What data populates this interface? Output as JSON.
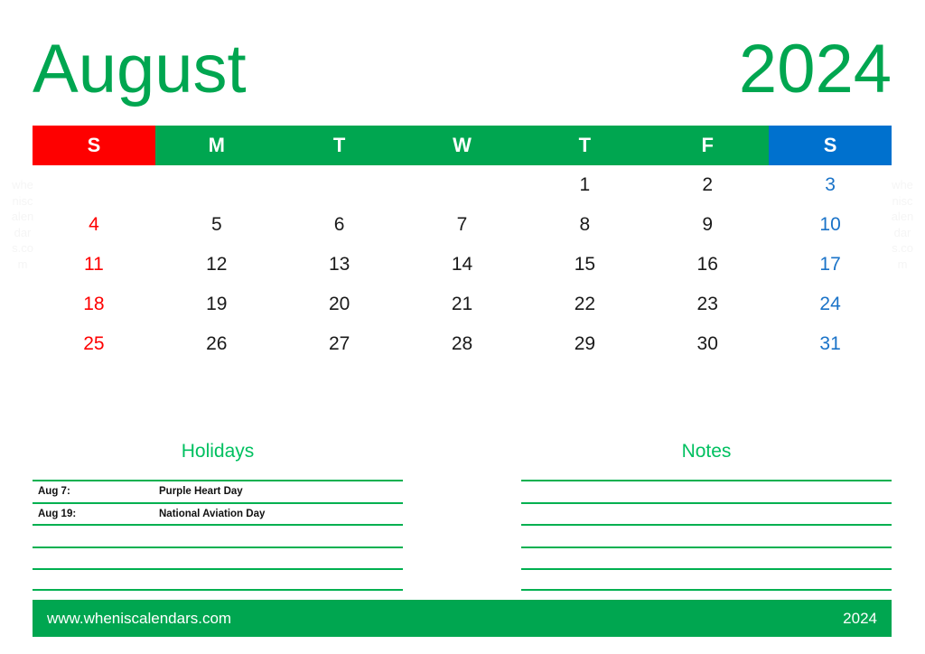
{
  "title": {
    "month": "August",
    "year": "2024"
  },
  "watermark": {
    "text": "wheniscalendars.com"
  },
  "colors": {
    "green": "#00a650",
    "green_light": "#00b050",
    "red": "#fe0000",
    "blue": "#0071ce",
    "date_blue": "#1a73c8",
    "date_black": "#1a1a1a",
    "title_green": "#00a650",
    "section_title_green": "#00c060",
    "watermark_gray": "#f5f5f5"
  },
  "weekdays": [
    {
      "label": "S",
      "kind": "sun"
    },
    {
      "label": "M",
      "kind": "weekday"
    },
    {
      "label": "T",
      "kind": "weekday"
    },
    {
      "label": "W",
      "kind": "weekday"
    },
    {
      "label": "T",
      "kind": "weekday"
    },
    {
      "label": "F",
      "kind": "weekday"
    },
    {
      "label": "S",
      "kind": "sat"
    }
  ],
  "weeks": [
    [
      {
        "day": "",
        "kind": "empty"
      },
      {
        "day": "",
        "kind": "empty"
      },
      {
        "day": "",
        "kind": "empty"
      },
      {
        "day": "",
        "kind": "empty"
      },
      {
        "day": "1",
        "kind": "weekday"
      },
      {
        "day": "2",
        "kind": "weekday"
      },
      {
        "day": "3",
        "kind": "sat"
      }
    ],
    [
      {
        "day": "4",
        "kind": "sun"
      },
      {
        "day": "5",
        "kind": "weekday"
      },
      {
        "day": "6",
        "kind": "weekday"
      },
      {
        "day": "7",
        "kind": "weekday"
      },
      {
        "day": "8",
        "kind": "weekday"
      },
      {
        "day": "9",
        "kind": "weekday"
      },
      {
        "day": "10",
        "kind": "sat"
      }
    ],
    [
      {
        "day": "11",
        "kind": "sun"
      },
      {
        "day": "12",
        "kind": "weekday"
      },
      {
        "day": "13",
        "kind": "weekday"
      },
      {
        "day": "14",
        "kind": "weekday"
      },
      {
        "day": "15",
        "kind": "weekday"
      },
      {
        "day": "16",
        "kind": "weekday"
      },
      {
        "day": "17",
        "kind": "sat"
      }
    ],
    [
      {
        "day": "18",
        "kind": "sun"
      },
      {
        "day": "19",
        "kind": "weekday"
      },
      {
        "day": "20",
        "kind": "weekday"
      },
      {
        "day": "21",
        "kind": "weekday"
      },
      {
        "day": "22",
        "kind": "weekday"
      },
      {
        "day": "23",
        "kind": "weekday"
      },
      {
        "day": "24",
        "kind": "sat"
      }
    ],
    [
      {
        "day": "25",
        "kind": "sun"
      },
      {
        "day": "26",
        "kind": "weekday"
      },
      {
        "day": "27",
        "kind": "weekday"
      },
      {
        "day": "28",
        "kind": "weekday"
      },
      {
        "day": "29",
        "kind": "weekday"
      },
      {
        "day": "30",
        "kind": "weekday"
      },
      {
        "day": "31",
        "kind": "sat"
      }
    ]
  ],
  "holidays": {
    "title": "Holidays",
    "rows": [
      {
        "date": "Aug 7:",
        "name": "Purple Heart Day"
      },
      {
        "date": "Aug 19:",
        "name": "National Aviation Day"
      },
      {
        "date": "",
        "name": ""
      },
      {
        "date": "",
        "name": ""
      },
      {
        "date": "",
        "name": ""
      }
    ]
  },
  "notes": {
    "title": "Notes",
    "rows": [
      {
        "date": "",
        "name": ""
      },
      {
        "date": "",
        "name": ""
      },
      {
        "date": "",
        "name": ""
      },
      {
        "date": "",
        "name": ""
      },
      {
        "date": "",
        "name": ""
      }
    ]
  },
  "footer": {
    "url": "www.wheniscalendars.com",
    "year": "2024"
  }
}
